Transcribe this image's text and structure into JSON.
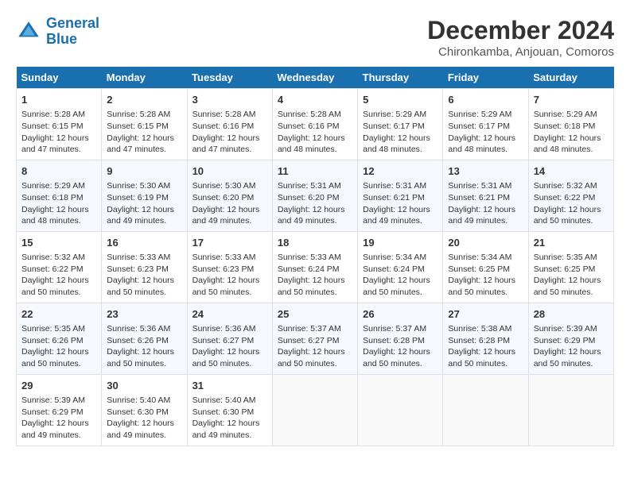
{
  "logo": {
    "line1": "General",
    "line2": "Blue"
  },
  "title": "December 2024",
  "subtitle": "Chironkamba, Anjouan, Comoros",
  "days_of_week": [
    "Sunday",
    "Monday",
    "Tuesday",
    "Wednesday",
    "Thursday",
    "Friday",
    "Saturday"
  ],
  "weeks": [
    [
      {
        "day": 1,
        "sunrise": "5:28 AM",
        "sunset": "6:15 PM",
        "daylight": "12 hours and 47 minutes."
      },
      {
        "day": 2,
        "sunrise": "5:28 AM",
        "sunset": "6:15 PM",
        "daylight": "12 hours and 47 minutes."
      },
      {
        "day": 3,
        "sunrise": "5:28 AM",
        "sunset": "6:16 PM",
        "daylight": "12 hours and 47 minutes."
      },
      {
        "day": 4,
        "sunrise": "5:28 AM",
        "sunset": "6:16 PM",
        "daylight": "12 hours and 48 minutes."
      },
      {
        "day": 5,
        "sunrise": "5:29 AM",
        "sunset": "6:17 PM",
        "daylight": "12 hours and 48 minutes."
      },
      {
        "day": 6,
        "sunrise": "5:29 AM",
        "sunset": "6:17 PM",
        "daylight": "12 hours and 48 minutes."
      },
      {
        "day": 7,
        "sunrise": "5:29 AM",
        "sunset": "6:18 PM",
        "daylight": "12 hours and 48 minutes."
      }
    ],
    [
      {
        "day": 8,
        "sunrise": "5:29 AM",
        "sunset": "6:18 PM",
        "daylight": "12 hours and 48 minutes."
      },
      {
        "day": 9,
        "sunrise": "5:30 AM",
        "sunset": "6:19 PM",
        "daylight": "12 hours and 49 minutes."
      },
      {
        "day": 10,
        "sunrise": "5:30 AM",
        "sunset": "6:20 PM",
        "daylight": "12 hours and 49 minutes."
      },
      {
        "day": 11,
        "sunrise": "5:31 AM",
        "sunset": "6:20 PM",
        "daylight": "12 hours and 49 minutes."
      },
      {
        "day": 12,
        "sunrise": "5:31 AM",
        "sunset": "6:21 PM",
        "daylight": "12 hours and 49 minutes."
      },
      {
        "day": 13,
        "sunrise": "5:31 AM",
        "sunset": "6:21 PM",
        "daylight": "12 hours and 49 minutes."
      },
      {
        "day": 14,
        "sunrise": "5:32 AM",
        "sunset": "6:22 PM",
        "daylight": "12 hours and 50 minutes."
      }
    ],
    [
      {
        "day": 15,
        "sunrise": "5:32 AM",
        "sunset": "6:22 PM",
        "daylight": "12 hours and 50 minutes."
      },
      {
        "day": 16,
        "sunrise": "5:33 AM",
        "sunset": "6:23 PM",
        "daylight": "12 hours and 50 minutes."
      },
      {
        "day": 17,
        "sunrise": "5:33 AM",
        "sunset": "6:23 PM",
        "daylight": "12 hours and 50 minutes."
      },
      {
        "day": 18,
        "sunrise": "5:33 AM",
        "sunset": "6:24 PM",
        "daylight": "12 hours and 50 minutes."
      },
      {
        "day": 19,
        "sunrise": "5:34 AM",
        "sunset": "6:24 PM",
        "daylight": "12 hours and 50 minutes."
      },
      {
        "day": 20,
        "sunrise": "5:34 AM",
        "sunset": "6:25 PM",
        "daylight": "12 hours and 50 minutes."
      },
      {
        "day": 21,
        "sunrise": "5:35 AM",
        "sunset": "6:25 PM",
        "daylight": "12 hours and 50 minutes."
      }
    ],
    [
      {
        "day": 22,
        "sunrise": "5:35 AM",
        "sunset": "6:26 PM",
        "daylight": "12 hours and 50 minutes."
      },
      {
        "day": 23,
        "sunrise": "5:36 AM",
        "sunset": "6:26 PM",
        "daylight": "12 hours and 50 minutes."
      },
      {
        "day": 24,
        "sunrise": "5:36 AM",
        "sunset": "6:27 PM",
        "daylight": "12 hours and 50 minutes."
      },
      {
        "day": 25,
        "sunrise": "5:37 AM",
        "sunset": "6:27 PM",
        "daylight": "12 hours and 50 minutes."
      },
      {
        "day": 26,
        "sunrise": "5:37 AM",
        "sunset": "6:28 PM",
        "daylight": "12 hours and 50 minutes."
      },
      {
        "day": 27,
        "sunrise": "5:38 AM",
        "sunset": "6:28 PM",
        "daylight": "12 hours and 50 minutes."
      },
      {
        "day": 28,
        "sunrise": "5:39 AM",
        "sunset": "6:29 PM",
        "daylight": "12 hours and 50 minutes."
      }
    ],
    [
      {
        "day": 29,
        "sunrise": "5:39 AM",
        "sunset": "6:29 PM",
        "daylight": "12 hours and 49 minutes."
      },
      {
        "day": 30,
        "sunrise": "5:40 AM",
        "sunset": "6:30 PM",
        "daylight": "12 hours and 49 minutes."
      },
      {
        "day": 31,
        "sunrise": "5:40 AM",
        "sunset": "6:30 PM",
        "daylight": "12 hours and 49 minutes."
      },
      null,
      null,
      null,
      null
    ]
  ]
}
